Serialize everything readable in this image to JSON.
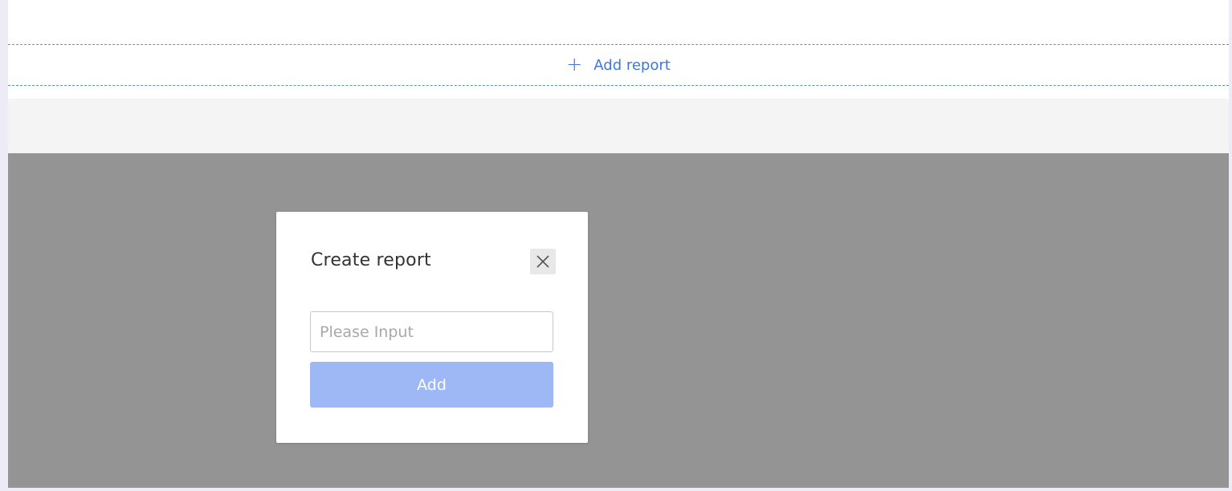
{
  "add_report": {
    "icon": "plus-icon",
    "plus_symbol": "+",
    "label": "Add report"
  },
  "dialog": {
    "title": "Create report",
    "close_icon": "close-icon",
    "input": {
      "value": "",
      "placeholder": "Please Input"
    },
    "submit_label": "Add"
  },
  "colors": {
    "accent": "#3f78d6",
    "overlay": "#949494",
    "submit_button_disabled": "#9db8f5"
  }
}
